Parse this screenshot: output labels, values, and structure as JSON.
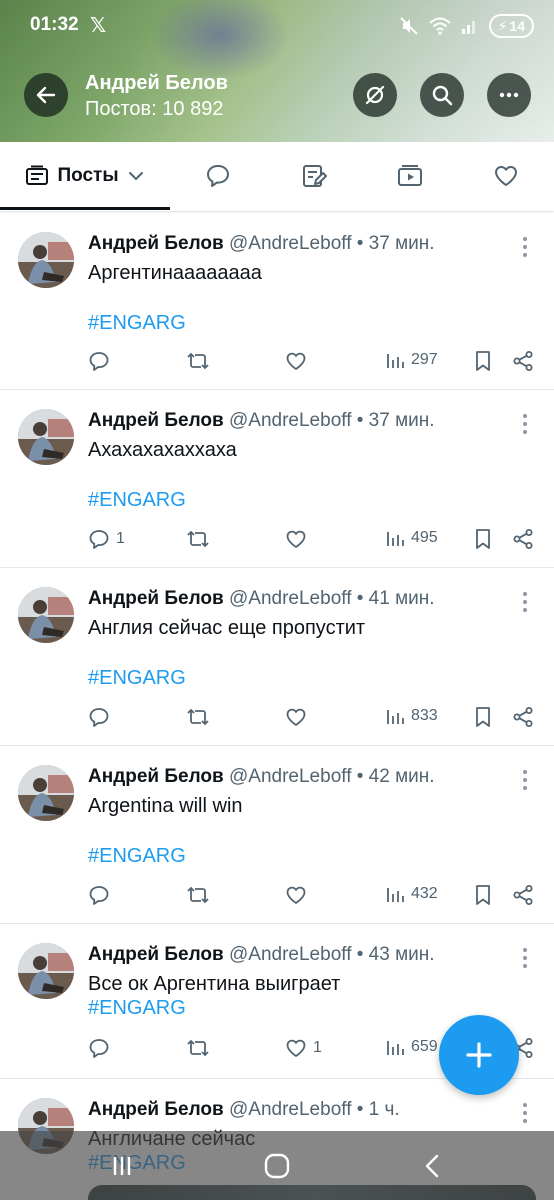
{
  "status_bar": {
    "time": "01:32",
    "x_icon": "x-logo-icon",
    "battery": "14"
  },
  "header": {
    "back_icon": "arrow-left-icon",
    "name": "Андрей Белов",
    "posts_count": "Постов: 10 892",
    "buttons": [
      "grok-icon",
      "search-icon",
      "more-icon"
    ]
  },
  "tabs": [
    {
      "name": "posts",
      "label": "Посты",
      "icon": "posts-list-icon",
      "active": true
    },
    {
      "name": "replies",
      "icon": "comment-icon"
    },
    {
      "name": "highlights",
      "icon": "article-edit-icon"
    },
    {
      "name": "media",
      "icon": "media-play-icon"
    },
    {
      "name": "likes",
      "icon": "heart-icon"
    }
  ],
  "posts": [
    {
      "author": "Андрей Белов",
      "meta": "@AndreLeboff • 37 мин.",
      "text": "Аргентинаааааааа",
      "hashtag": "#ENGARG",
      "replies": "",
      "likes": "",
      "views": "297"
    },
    {
      "author": "Андрей Белов",
      "meta": "@AndreLeboff • 37 мин.",
      "text": "Ахахахахаххаха",
      "hashtag": "#ENGARG",
      "replies": "1",
      "likes": "",
      "views": "495"
    },
    {
      "author": "Андрей Белов",
      "meta": "@AndreLeboff • 41 мин.",
      "text": "Англия сейчас еще пропустит",
      "hashtag": "#ENGARG",
      "replies": "",
      "likes": "",
      "views": "833"
    },
    {
      "author": "Андрей Белов",
      "meta": "@AndreLeboff • 42 мин.",
      "text": "Argentina will win",
      "hashtag": "#ENGARG",
      "replies": "",
      "likes": "",
      "views": "432"
    },
    {
      "author": "Андрей Белов",
      "meta": "@AndreLeboff • 43 мин.",
      "text": "Все ок Аргентина выиграет",
      "hashtag": "#ENGARG",
      "replies": "",
      "likes": "1",
      "views": "659"
    },
    {
      "author": "Андрей Белов",
      "meta": "@AndreLeboff • 1 ч.",
      "text": "Англичане сейчас",
      "hashtag": "#ENGARG"
    }
  ],
  "colors": {
    "accent": "#1d9bf0",
    "text": "#0f1419",
    "muted": "#536471"
  }
}
